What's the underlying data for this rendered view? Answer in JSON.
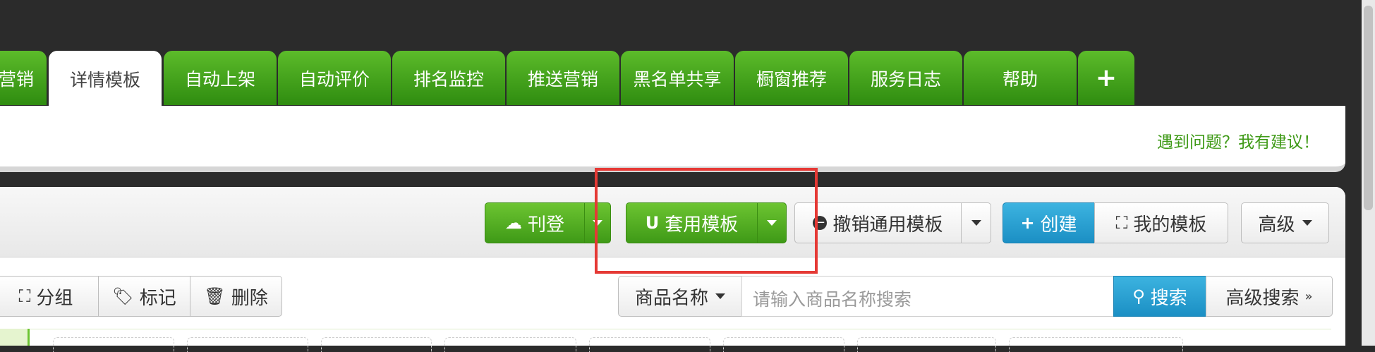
{
  "tabs": [
    {
      "label": "营销"
    },
    {
      "label": "详情模板"
    },
    {
      "label": "自动上架"
    },
    {
      "label": "自动评价"
    },
    {
      "label": "排名监控"
    },
    {
      "label": "推送营销"
    },
    {
      "label": "黑名单共享"
    },
    {
      "label": "橱窗推荐"
    },
    {
      "label": "服务日志"
    },
    {
      "label": "帮助"
    },
    {
      "label": "+"
    }
  ],
  "feedback_link": "遇到问题？我有建议！",
  "toolbar": {
    "publish": "刊登",
    "apply_template": "套用模板",
    "revoke_template": "撤销通用模板",
    "create": "创建",
    "my_templates": "我的模板",
    "advanced": "高级"
  },
  "actions": {
    "group": "分组",
    "tag": "标记",
    "delete": "删除"
  },
  "search": {
    "field_select": "商品名称",
    "placeholder": "请输入商品名称搜索",
    "search_button": "搜索",
    "advanced_search": "高级搜索"
  },
  "colors": {
    "tab_green": "#3f9a17",
    "link_green": "#3f9a17",
    "highlight_red": "#e53935",
    "search_blue": "#1b8fc4"
  }
}
